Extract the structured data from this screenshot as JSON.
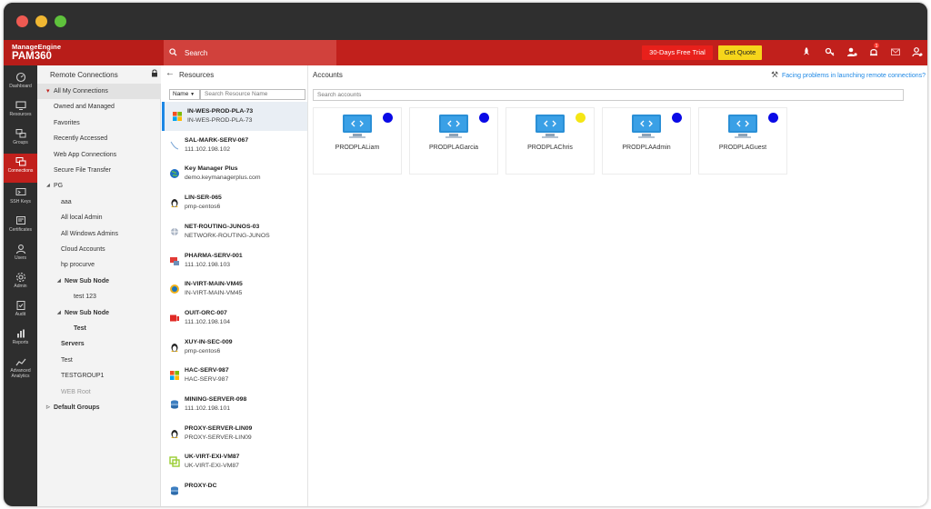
{
  "brand": {
    "company": "ManageEngine",
    "product": "PAM360"
  },
  "header": {
    "search_placeholder": "Search",
    "trial_label": "30-Days Free Trial",
    "quote_label": "Get Quote",
    "icons": [
      "rocket-icon",
      "key-icon",
      "user-alert-icon",
      "bell-icon",
      "mail-icon",
      "user-icon"
    ],
    "notification_count": "1"
  },
  "leftnav": [
    {
      "label": "Dashboard",
      "icon": "dashboard-icon"
    },
    {
      "label": "Resources",
      "icon": "monitor-icon"
    },
    {
      "label": "Groups",
      "icon": "groups-icon"
    },
    {
      "label": "Connections",
      "icon": "connections-icon",
      "active": true
    },
    {
      "label": "SSH Keys",
      "icon": "ssh-key-icon"
    },
    {
      "label": "Certificates",
      "icon": "certificate-icon"
    },
    {
      "label": "Users",
      "icon": "users-icon"
    },
    {
      "label": "Admin",
      "icon": "gear-icon"
    },
    {
      "label": "Audit",
      "icon": "audit-icon"
    },
    {
      "label": "Reports",
      "icon": "reports-icon"
    },
    {
      "label": "Advanced Analytics",
      "icon": "analytics-icon"
    }
  ],
  "tree": {
    "title": "Remote Connections",
    "items": [
      {
        "label": "All My Connections",
        "level": 0,
        "active": true,
        "pin": true
      },
      {
        "label": "Owned and Managed",
        "level": 0
      },
      {
        "label": "Favorites",
        "level": 0
      },
      {
        "label": "Recently Accessed",
        "level": 0
      },
      {
        "label": "Web App Connections",
        "level": 0
      },
      {
        "label": "Secure File Transfer",
        "level": 0
      },
      {
        "label": "PG",
        "level": 0,
        "expanded": true
      },
      {
        "label": "aaa",
        "level": 1
      },
      {
        "label": "All local Admin",
        "level": 1
      },
      {
        "label": "All Windows Admins",
        "level": 1
      },
      {
        "label": "Cloud Accounts",
        "level": 1
      },
      {
        "label": "hp procurve",
        "level": 1
      },
      {
        "label": "New Sub Node",
        "level": 1,
        "expanded": true,
        "bold": true
      },
      {
        "label": "test 123",
        "level": 2
      },
      {
        "label": "New Sub Node",
        "level": 1,
        "expanded": true,
        "bold": true
      },
      {
        "label": "Test",
        "level": 2,
        "bold": true
      },
      {
        "label": "Servers",
        "level": 1,
        "bold": true
      },
      {
        "label": "Test",
        "level": 1
      },
      {
        "label": "TESTGROUP1",
        "level": 1
      },
      {
        "label": "WEB Root",
        "level": 1,
        "dim": true
      },
      {
        "label": "Default Groups",
        "level": 0,
        "collapsed": true,
        "bold": true
      }
    ]
  },
  "resources": {
    "title": "Resources",
    "filter_label": "Name",
    "search_placeholder": "Search Resource Name",
    "items": [
      {
        "name": "IN-WES-PROD-PLA-73",
        "sub": "IN-WES-PROD-PLA-73",
        "icon": "windows-icon",
        "active": true
      },
      {
        "name": "SAL-MARK-SERV-067",
        "sub": "111.102.198.102",
        "icon": "network-icon"
      },
      {
        "name": "Key Manager Plus",
        "sub": "demo.keymanagerplus.com",
        "icon": "globe-icon"
      },
      {
        "name": "LIN-SER-065",
        "sub": "pmp-centos6",
        "icon": "linux-icon"
      },
      {
        "name": "NET-ROUTING-JUNOS-03",
        "sub": "NETWORK-ROUTING-JUNOS",
        "icon": "router-icon"
      },
      {
        "name": "PHARMA-SERV-001",
        "sub": "111.102.198.103",
        "icon": "server-alert-icon"
      },
      {
        "name": "IN-VIRT-MAIN-VM45",
        "sub": "IN-VIRT-MAIN-VM45",
        "icon": "vm-icon"
      },
      {
        "name": "OUIT-ORC-007",
        "sub": "111.102.198.104",
        "icon": "oracle-icon"
      },
      {
        "name": "XUY-IN-SEC-009",
        "sub": "pmp-centos6",
        "icon": "linux-icon"
      },
      {
        "name": "HAC-SERV-987",
        "sub": "HAC-SERV-987",
        "icon": "windows-icon"
      },
      {
        "name": "MINING-SERVER-098",
        "sub": "111.102.198.101",
        "icon": "database-icon"
      },
      {
        "name": "PROXY-SERVER-LIN09",
        "sub": "PROXY-SERVER-LIN09",
        "icon": "linux-icon"
      },
      {
        "name": "UK-VIRT-EXI-VM87",
        "sub": "UK-VIRT-EXI-VM87",
        "icon": "esxi-icon"
      },
      {
        "name": "PROXY-DC",
        "sub": "",
        "icon": "database-icon"
      }
    ]
  },
  "accounts": {
    "title": "Accounts",
    "help_text": "Facing problems in launching remote connections?",
    "search_placeholder": "Search accounts",
    "items": [
      {
        "name": "PRODPLALiam",
        "status_color": "#0a0ae6"
      },
      {
        "name": "PRODPLAGarcia",
        "status_color": "#0a0ae6"
      },
      {
        "name": "PRODPLAChris",
        "status_color": "#f5e615"
      },
      {
        "name": "PRODPLAAdmin",
        "status_color": "#0a0ae6"
      },
      {
        "name": "PRODPLAGuest",
        "status_color": "#0a0ae6"
      }
    ]
  },
  "colors": {
    "brand_red": "#c1201c",
    "accent_blue": "#1e88e5",
    "monitor_blue": "#2a8fd6"
  }
}
